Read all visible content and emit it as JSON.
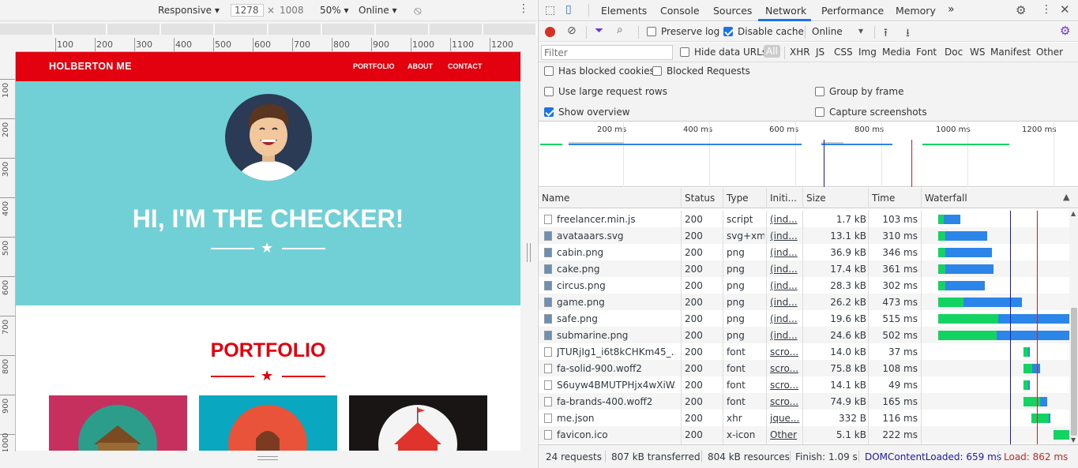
{
  "device_toolbar": {
    "device": "Responsive",
    "width": "1278",
    "times": "×",
    "height": "1008",
    "zoom": "50%",
    "throttle": "Online"
  },
  "ruler_top": [
    "100",
    "200",
    "300",
    "400",
    "500",
    "600",
    "700",
    "800",
    "900",
    "1000",
    "1100",
    "1200"
  ],
  "ruler_left": [
    "100",
    "200",
    "300",
    "400",
    "500",
    "600",
    "700",
    "800",
    "900",
    "1000"
  ],
  "site": {
    "brand": "HOLBERTON ME",
    "nav": [
      "PORTFOLIO",
      "ABOUT",
      "CONTACT"
    ],
    "hero_title": "HI, I'M THE CHECKER!",
    "portfolio_title": "PORTFOLIO",
    "colors": {
      "nav": "#e3000f",
      "hero": "#71d0d6"
    }
  },
  "devtools": {
    "tabs": [
      "Elements",
      "Console",
      "Sources",
      "Network",
      "Performance",
      "Memory"
    ],
    "active_tab": "Network",
    "more": "»",
    "preserve_log": "Preserve log",
    "disable_cache": "Disable cache",
    "throttle": "Online",
    "filter_placeholder": "Filter",
    "hide_data_urls": "Hide data URLs",
    "types": [
      "All",
      "XHR",
      "JS",
      "CSS",
      "Img",
      "Media",
      "Font",
      "Doc",
      "WS",
      "Manifest",
      "Other"
    ],
    "has_blocked_cookies": "Has blocked cookies",
    "blocked_requests": "Blocked Requests",
    "large_rows": "Use large request rows",
    "group_by_frame": "Group by frame",
    "show_overview": "Show overview",
    "capture_screenshots": "Capture screenshots",
    "timeline_ticks": [
      "200 ms",
      "400 ms",
      "600 ms",
      "800 ms",
      "1000 ms",
      "1200 ms"
    ],
    "columns": [
      "Name",
      "Status",
      "Type",
      "Initi...",
      "Size",
      "Time",
      "Waterfall"
    ],
    "rows": [
      {
        "name": "freelancer.min.js",
        "status": "200",
        "type": "script",
        "initiator": "(ind...",
        "size": "1.7 kB",
        "time": "103 ms",
        "wait": [
          0.03,
          0.04
        ],
        "dl": [
          0.07,
          0.11
        ],
        "icon": "doc"
      },
      {
        "name": "avataaars.svg",
        "status": "200",
        "type": "svg+xml",
        "initiator": "(ind...",
        "size": "13.1 kB",
        "time": "310 ms",
        "wait": [
          0.03,
          0.05
        ],
        "dl": [
          0.08,
          0.28
        ],
        "icon": "img"
      },
      {
        "name": "cabin.png",
        "status": "200",
        "type": "png",
        "initiator": "(ind...",
        "size": "36.9 kB",
        "time": "346 ms",
        "wait": [
          0.03,
          0.05
        ],
        "dl": [
          0.08,
          0.31
        ],
        "icon": "img"
      },
      {
        "name": "cake.png",
        "status": "200",
        "type": "png",
        "initiator": "(ind...",
        "size": "17.4 kB",
        "time": "361 ms",
        "wait": [
          0.03,
          0.05
        ],
        "dl": [
          0.08,
          0.32
        ],
        "icon": "img"
      },
      {
        "name": "circus.png",
        "status": "200",
        "type": "png",
        "initiator": "(ind...",
        "size": "28.3 kB",
        "time": "302 ms",
        "wait": [
          0.03,
          0.05
        ],
        "dl": [
          0.08,
          0.26
        ],
        "icon": "img"
      },
      {
        "name": "game.png",
        "status": "200",
        "type": "png",
        "initiator": "(ind...",
        "size": "26.2 kB",
        "time": "473 ms",
        "wait": [
          0.03,
          0.17
        ],
        "dl": [
          0.2,
          0.39
        ],
        "icon": "img"
      },
      {
        "name": "safe.png",
        "status": "200",
        "type": "png",
        "initiator": "(ind...",
        "size": "19.6 kB",
        "time": "515 ms",
        "wait": [
          0.03,
          0.4
        ],
        "dl": [
          0.43,
          0.53
        ],
        "icon": "img"
      },
      {
        "name": "submarine.png",
        "status": "200",
        "type": "png",
        "initiator": "(ind...",
        "size": "24.6 kB",
        "time": "502 ms",
        "wait": [
          0.03,
          0.39
        ],
        "dl": [
          0.42,
          0.52
        ],
        "icon": "img"
      },
      {
        "name": "JTURjIg1_i6t8kCHKm45_...",
        "status": "200",
        "type": "font",
        "initiator": "scro...",
        "size": "14.0 kB",
        "time": "37 ms",
        "wait": [
          0.6,
          0.03
        ],
        "dl": [
          0.63,
          0.01
        ],
        "icon": "doc"
      },
      {
        "name": "fa-solid-900.woff2",
        "status": "200",
        "type": "font",
        "initiator": "scro...",
        "size": "75.8 kB",
        "time": "108 ms",
        "wait": [
          0.6,
          0.06
        ],
        "dl": [
          0.66,
          0.05
        ],
        "icon": "doc"
      },
      {
        "name": "S6uyw4BMUTPHjx4wXiW...",
        "status": "200",
        "type": "font",
        "initiator": "scro...",
        "size": "14.1 kB",
        "time": "49 ms",
        "wait": [
          0.6,
          0.03
        ],
        "dl": [
          0.63,
          0.01
        ],
        "icon": "doc"
      },
      {
        "name": "fa-brands-400.woff2",
        "status": "200",
        "type": "font",
        "initiator": "scro...",
        "size": "74.9 kB",
        "time": "165 ms",
        "wait": [
          0.6,
          0.11
        ],
        "dl": [
          0.71,
          0.05
        ],
        "icon": "doc"
      },
      {
        "name": "me.json",
        "status": "200",
        "type": "xhr",
        "initiator": "jque...",
        "size": "332 B",
        "time": "116 ms",
        "wait": [
          0.65,
          0.12
        ],
        "dl": [
          0.77,
          0.01
        ],
        "icon": "doc"
      },
      {
        "name": "favicon.ico",
        "status": "200",
        "type": "x-icon",
        "initiator": "Other",
        "size": "5.1 kB",
        "time": "222 ms",
        "wait": [
          0.8,
          0.2
        ],
        "dl": [
          1.0,
          0.0
        ],
        "icon": "doc"
      }
    ],
    "status": {
      "requests": "24 requests",
      "transferred": "807 kB transferred",
      "resources": "804 kB resources",
      "finish": "Finish: 1.09 s",
      "dcl": "DOMContentLoaded: 659 ms",
      "load": "Load: 862 ms"
    },
    "colors": {
      "wait": "#13d463",
      "download": "#2c85e9",
      "dcl": "#1a1aad",
      "load": "#c62828"
    }
  }
}
